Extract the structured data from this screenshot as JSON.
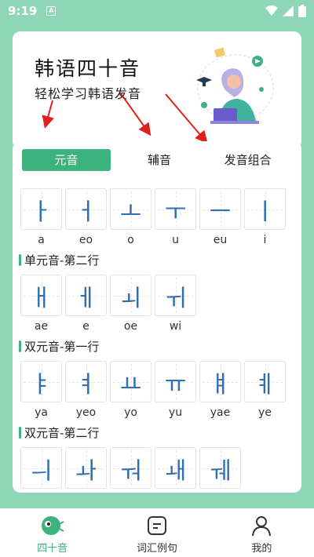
{
  "status": {
    "time": "9:19",
    "notif": "A"
  },
  "header": {
    "title": "韩语四十音",
    "subtitle": "轻松学习韩语发音"
  },
  "tabs": [
    {
      "label": "元音",
      "active": true
    },
    {
      "label": "辅音",
      "active": false
    },
    {
      "label": "发音组合",
      "active": false
    }
  ],
  "sections": [
    {
      "label": "",
      "items": [
        {
          "hangul": "ㅏ",
          "roman": "a"
        },
        {
          "hangul": "ㅓ",
          "roman": "eo"
        },
        {
          "hangul": "ㅗ",
          "roman": "o"
        },
        {
          "hangul": "ㅜ",
          "roman": "u"
        },
        {
          "hangul": "ㅡ",
          "roman": "eu"
        },
        {
          "hangul": "ㅣ",
          "roman": "i"
        }
      ]
    },
    {
      "label": "单元音-第二行",
      "items": [
        {
          "hangul": "ㅐ",
          "roman": "ae"
        },
        {
          "hangul": "ㅔ",
          "roman": "e"
        },
        {
          "hangul": "ㅚ",
          "roman": "oe"
        },
        {
          "hangul": "ㅟ",
          "roman": "wi"
        }
      ]
    },
    {
      "label": "双元音-第一行",
      "items": [
        {
          "hangul": "ㅑ",
          "roman": "ya"
        },
        {
          "hangul": "ㅕ",
          "roman": "yeo"
        },
        {
          "hangul": "ㅛ",
          "roman": "yo"
        },
        {
          "hangul": "ㅠ",
          "roman": "yu"
        },
        {
          "hangul": "ㅒ",
          "roman": "yae"
        },
        {
          "hangul": "ㅖ",
          "roman": "ye"
        }
      ]
    },
    {
      "label": "双元音-第二行",
      "items": [
        {
          "hangul": "ㅢ",
          "roman": ""
        },
        {
          "hangul": "ㅘ",
          "roman": ""
        },
        {
          "hangul": "ㅝ",
          "roman": ""
        },
        {
          "hangul": "ㅙ",
          "roman": ""
        },
        {
          "hangul": "ㅞ",
          "roman": ""
        }
      ]
    }
  ],
  "nav": [
    {
      "label": "四十音",
      "icon": "mascot-icon",
      "active": true
    },
    {
      "label": "词汇例句",
      "icon": "message-icon",
      "active": false
    },
    {
      "label": "我的",
      "icon": "person-icon",
      "active": false
    }
  ],
  "colors": {
    "accent": "#3cb37f",
    "background": "#8fd6b8",
    "hangul": "#2f6fb0",
    "arrow": "#e0201c"
  }
}
